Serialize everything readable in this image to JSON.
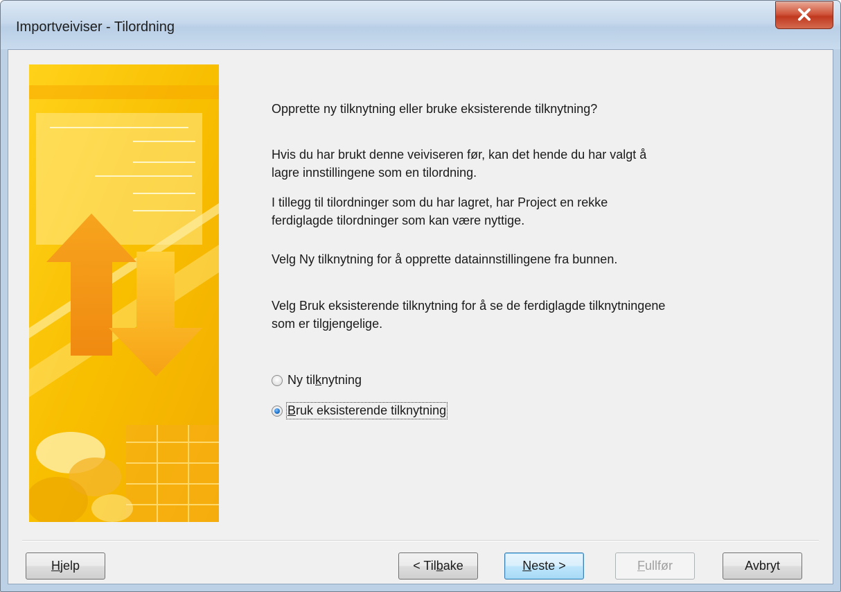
{
  "window": {
    "title": "Importveiviser - Tilordning"
  },
  "content": {
    "heading": "Opprette ny tilknytning eller bruke eksisterende tilknytning?",
    "para1_line1": "Hvis du har brukt denne veiviseren før, kan det hende du har valgt å",
    "para1_line2": "lagre innstillingene som en tilordning.",
    "para2_line1": "I tillegg til tilordninger som du har lagret, har Project en rekke",
    "para2_line2": "ferdiglagde tilordninger som kan være nyttige.",
    "para3": "Velg Ny tilknytning for å opprette datainnstillingene fra bunnen.",
    "para4_line1": "Velg Bruk eksisterende tilknytning for å se de ferdiglagde tilknytningene",
    "para4_line2": "som er tilgjengelige."
  },
  "options": {
    "new_label_pre": "Ny til",
    "new_label_acc": "k",
    "new_label_post": "nytning",
    "new_checked": false,
    "existing_label_acc": "B",
    "existing_label_post": "ruk eksisterende tilknytning",
    "existing_checked": true
  },
  "buttons": {
    "help_acc": "H",
    "help_post": "jelp",
    "back_pre": "< Til",
    "back_acc": "b",
    "back_post": "ake",
    "next_acc": "N",
    "next_post": "este >",
    "finish_acc": "F",
    "finish_post": "ullfør",
    "finish_enabled": false,
    "cancel": "Avbryt"
  },
  "colors": {
    "banner_primary": "#f7b500",
    "banner_light": "#ffe066",
    "arrow": "#f39a1b",
    "default_button_border": "#3c7fb1",
    "radio_selected": "#1b6fc9"
  }
}
